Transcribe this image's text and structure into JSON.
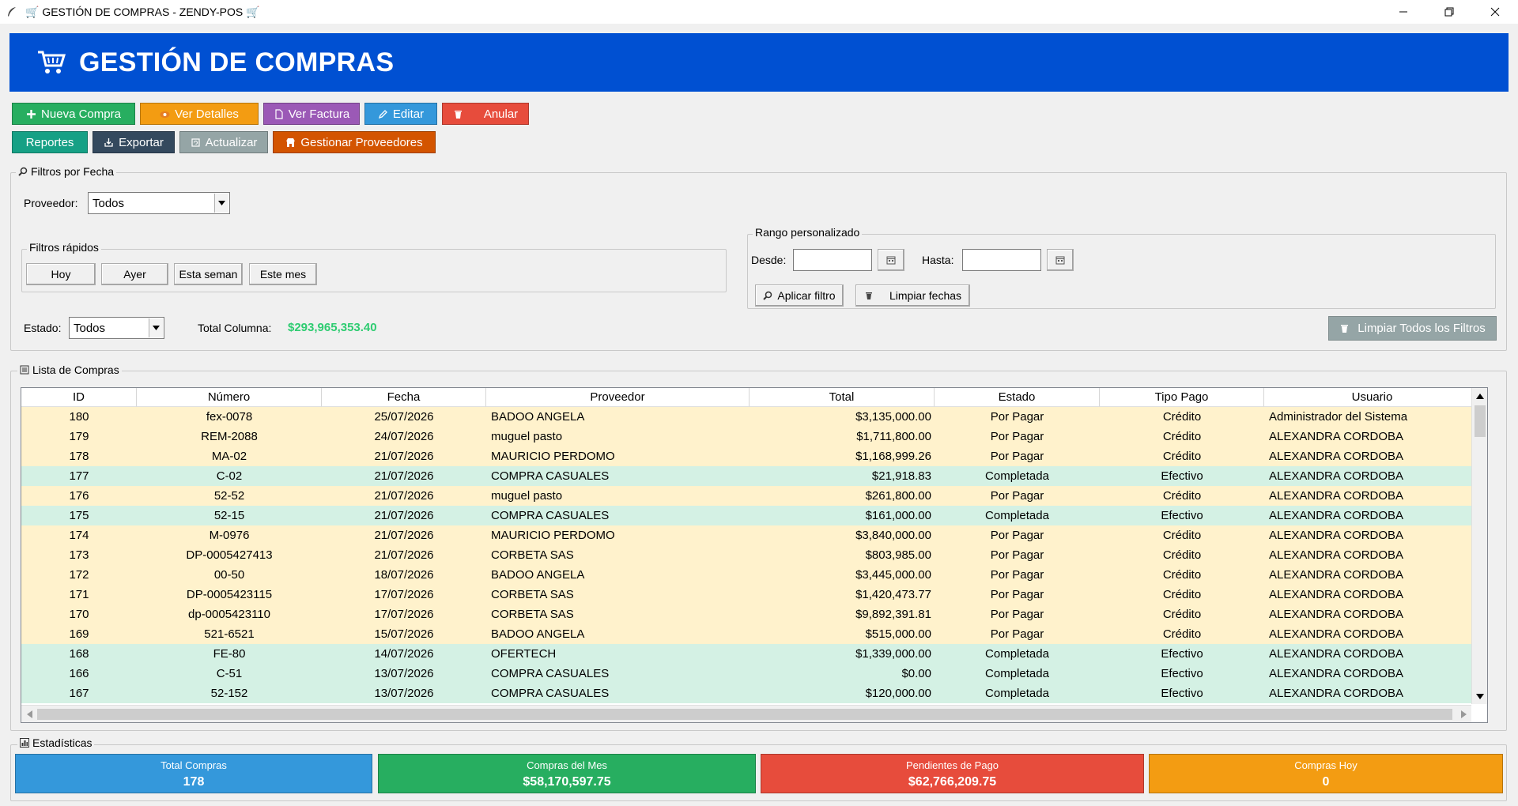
{
  "window": {
    "title": "🛒 GESTIÓN DE COMPRAS - ZENDY-POS 🛒"
  },
  "header": {
    "title": "GESTIÓN DE COMPRAS",
    "color": "#0050d2"
  },
  "toolbar": {
    "row1": [
      {
        "label": "Nueva Compra",
        "icon": "plus-icon",
        "color": "#27ae60"
      },
      {
        "label": "Ver Detalles",
        "icon": "eye-icon",
        "color": "#f39c12"
      },
      {
        "label": "Ver Factura",
        "icon": "document-icon",
        "color": "#9b59b6"
      },
      {
        "label": "Editar",
        "icon": "pencil-icon",
        "color": "#3498db"
      },
      {
        "label": "Anular",
        "icon": "trash-icon",
        "color": "#e74c3c"
      }
    ],
    "row2": [
      {
        "label": "Reportes",
        "icon": "",
        "color": "#16a085"
      },
      {
        "label": "Exportar",
        "icon": "export-icon",
        "color": "#34495e"
      },
      {
        "label": "Actualizar",
        "icon": "refresh-icon",
        "color": "#95a5a6"
      },
      {
        "label": "Gestionar Proveedores",
        "icon": "store-icon",
        "color": "#d35400"
      }
    ]
  },
  "filters": {
    "legend": "Filtros por Fecha",
    "proveedor_label": "Proveedor:",
    "proveedor_value": "Todos",
    "quick": {
      "legend": "Filtros rápidos",
      "buttons": [
        "Hoy",
        "Ayer",
        "Esta seman",
        "Este mes"
      ]
    },
    "range": {
      "legend": "Rango personalizado",
      "desde_label": "Desde:",
      "hasta_label": "Hasta:",
      "desde_value": "",
      "hasta_value": "",
      "apply_label": "Aplicar filtro",
      "clear_label": "Limpiar fechas"
    },
    "estado_label": "Estado:",
    "estado_value": "Todos",
    "total_label": "Total Columna:",
    "total_value": "$293,965,353.40",
    "clear_all_label": "Limpiar Todos los Filtros"
  },
  "list": {
    "legend": "Lista de Compras",
    "columns": [
      "ID",
      "Número",
      "Fecha",
      "Proveedor",
      "Total",
      "Estado",
      "Tipo Pago",
      "Usuario"
    ],
    "row_colors": {
      "pending": "#fff2cc",
      "completed": "#d4f1e4"
    },
    "rows": [
      {
        "id": "180",
        "numero": "fex-0078",
        "fecha": "25/07/2026",
        "proveedor": "BADOO ANGELA",
        "total": "$3,135,000.00",
        "estado": "Por Pagar",
        "tipo": "Crédito",
        "usuario": "Administrador del Sistema",
        "status": "pending"
      },
      {
        "id": "179",
        "numero": "REM-2088",
        "fecha": "24/07/2026",
        "proveedor": "muguel pasto",
        "total": "$1,711,800.00",
        "estado": "Por Pagar",
        "tipo": "Crédito",
        "usuario": "ALEXANDRA CORDOBA",
        "status": "pending"
      },
      {
        "id": "178",
        "numero": "MA-02",
        "fecha": "21/07/2026",
        "proveedor": "MAURICIO PERDOMO",
        "total": "$1,168,999.26",
        "estado": "Por Pagar",
        "tipo": "Crédito",
        "usuario": "ALEXANDRA CORDOBA",
        "status": "pending"
      },
      {
        "id": "177",
        "numero": "C-02",
        "fecha": "21/07/2026",
        "proveedor": "COMPRA CASUALES",
        "total": "$21,918.83",
        "estado": "Completada",
        "tipo": "Efectivo",
        "usuario": "ALEXANDRA CORDOBA",
        "status": "completed"
      },
      {
        "id": "176",
        "numero": "52-52",
        "fecha": "21/07/2026",
        "proveedor": "muguel pasto",
        "total": "$261,800.00",
        "estado": "Por Pagar",
        "tipo": "Crédito",
        "usuario": "ALEXANDRA CORDOBA",
        "status": "pending"
      },
      {
        "id": "175",
        "numero": "52-15",
        "fecha": "21/07/2026",
        "proveedor": "COMPRA CASUALES",
        "total": "$161,000.00",
        "estado": "Completada",
        "tipo": "Efectivo",
        "usuario": "ALEXANDRA CORDOBA",
        "status": "completed"
      },
      {
        "id": "174",
        "numero": "M-0976",
        "fecha": "21/07/2026",
        "proveedor": "MAURICIO PERDOMO",
        "total": "$3,840,000.00",
        "estado": "Por Pagar",
        "tipo": "Crédito",
        "usuario": "ALEXANDRA CORDOBA",
        "status": "pending"
      },
      {
        "id": "173",
        "numero": "DP-0005427413",
        "fecha": "21/07/2026",
        "proveedor": "CORBETA SAS",
        "total": "$803,985.00",
        "estado": "Por Pagar",
        "tipo": "Crédito",
        "usuario": "ALEXANDRA CORDOBA",
        "status": "pending"
      },
      {
        "id": "172",
        "numero": "00-50",
        "fecha": "18/07/2026",
        "proveedor": "BADOO ANGELA",
        "total": "$3,445,000.00",
        "estado": "Por Pagar",
        "tipo": "Crédito",
        "usuario": "ALEXANDRA CORDOBA",
        "status": "pending"
      },
      {
        "id": "171",
        "numero": "DP-0005423115",
        "fecha": "17/07/2026",
        "proveedor": "CORBETA SAS",
        "total": "$1,420,473.77",
        "estado": "Por Pagar",
        "tipo": "Crédito",
        "usuario": "ALEXANDRA CORDOBA",
        "status": "pending"
      },
      {
        "id": "170",
        "numero": "dp-0005423110",
        "fecha": "17/07/2026",
        "proveedor": "CORBETA SAS",
        "total": "$9,892,391.81",
        "estado": "Por Pagar",
        "tipo": "Crédito",
        "usuario": "ALEXANDRA CORDOBA",
        "status": "pending"
      },
      {
        "id": "169",
        "numero": "521-6521",
        "fecha": "15/07/2026",
        "proveedor": "BADOO ANGELA",
        "total": "$515,000.00",
        "estado": "Por Pagar",
        "tipo": "Crédito",
        "usuario": "ALEXANDRA CORDOBA",
        "status": "pending"
      },
      {
        "id": "168",
        "numero": "FE-80",
        "fecha": "14/07/2026",
        "proveedor": "OFERTECH",
        "total": "$1,339,000.00",
        "estado": "Completada",
        "tipo": "Efectivo",
        "usuario": "ALEXANDRA CORDOBA",
        "status": "completed"
      },
      {
        "id": "166",
        "numero": "C-51",
        "fecha": "13/07/2026",
        "proveedor": "COMPRA CASUALES",
        "total": "$0.00",
        "estado": "Completada",
        "tipo": "Efectivo",
        "usuario": "ALEXANDRA CORDOBA",
        "status": "completed"
      },
      {
        "id": "167",
        "numero": "52-152",
        "fecha": "13/07/2026",
        "proveedor": "COMPRA CASUALES",
        "total": "$120,000.00",
        "estado": "Completada",
        "tipo": "Efectivo",
        "usuario": "ALEXANDRA CORDOBA",
        "status": "completed"
      }
    ]
  },
  "stats": {
    "legend": "Estadísticas",
    "cards": [
      {
        "title": "Total Compras",
        "value": "178",
        "color": "#3498db"
      },
      {
        "title": "Compras del Mes",
        "value": "$58,170,597.75",
        "color": "#27ae60"
      },
      {
        "title": "Pendientes de Pago",
        "value": "$62,766,209.75",
        "color": "#e74c3c"
      },
      {
        "title": "Compras Hoy",
        "value": "0",
        "color": "#f39c12"
      }
    ]
  }
}
